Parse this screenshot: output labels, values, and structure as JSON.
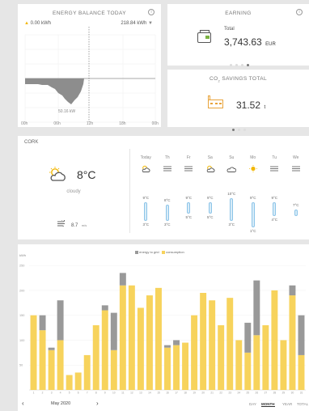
{
  "energy": {
    "title": "ENERGY BALANCE TODAY",
    "left_value": "0.00 kWh",
    "right_value": "218.84 kWh",
    "min_label": "50.16 kW",
    "x_ticks": [
      "00h",
      "06h",
      "12h",
      "18h",
      "00h"
    ]
  },
  "earning": {
    "title": "EARNING",
    "label": "Total",
    "value": "3,743.63",
    "unit": "EUR"
  },
  "savings": {
    "title": "CO2 SAVINGS TOTAL",
    "value": "31.52",
    "unit": "t"
  },
  "weather": {
    "city": "CORK",
    "temp": "8°C",
    "condition": "cloudy",
    "wind": "8.7",
    "wind_unit": "m/s",
    "days": [
      {
        "name": "Today",
        "icon": "partly-cloudy",
        "max": "9°C",
        "min": "3°C",
        "fmax": 0.6,
        "fmin": 0.2
      },
      {
        "name": "Th",
        "icon": "fog",
        "max": "8°C",
        "min": "3°C",
        "fmax": 0.55,
        "fmin": 0.2
      },
      {
        "name": "Fr",
        "icon": "fog",
        "max": "9°C",
        "min": "5°C",
        "fmax": 0.6,
        "fmin": 0.35
      },
      {
        "name": "Sa",
        "icon": "partly-cloudy",
        "max": "9°C",
        "min": "5°C",
        "fmax": 0.6,
        "fmin": 0.35
      },
      {
        "name": "Su",
        "icon": "cloud",
        "max": "10°C",
        "min": "3°C",
        "fmax": 0.7,
        "fmin": 0.2
      },
      {
        "name": "Mo",
        "icon": "sun",
        "max": "9°C",
        "min": "1°C",
        "fmax": 0.6,
        "fmin": 0.05
      },
      {
        "name": "Tu",
        "icon": "fog",
        "max": "9°C",
        "min": "4°C",
        "fmax": 0.6,
        "fmin": 0.3
      },
      {
        "name": "We",
        "icon": "fog",
        "max": "7°C",
        "min": "",
        "fmax": 0.45,
        "fmin": 0.3
      }
    ]
  },
  "chart_data": {
    "type": "bar",
    "legend": [
      "energy to grid",
      "consumption"
    ],
    "colors": {
      "grid": "#999999",
      "consumption": "#f7d35c"
    },
    "ylabel": "kWh",
    "y_ticks": [
      "250",
      "200",
      "150",
      "100",
      "50"
    ],
    "ylim": [
      0,
      260
    ],
    "categories": [
      "1",
      "2",
      "3",
      "4",
      "5",
      "6",
      "7",
      "8",
      "9",
      "10",
      "11",
      "12",
      "13",
      "14",
      "15",
      "16",
      "17",
      "18",
      "19",
      "20",
      "21",
      "22",
      "23",
      "24",
      "25",
      "26",
      "27",
      "28",
      "29",
      "30",
      "31"
    ],
    "series": [
      {
        "name": "consumption",
        "values": [
          150,
          120,
          80,
          100,
          30,
          35,
          70,
          130,
          160,
          80,
          210,
          210,
          165,
          190,
          205,
          85,
          90,
          95,
          150,
          195,
          180,
          130,
          185,
          100,
          75,
          110,
          130,
          200,
          100,
          190,
          70
        ]
      },
      {
        "name": "energy to grid",
        "values": [
          0,
          30,
          5,
          80,
          0,
          0,
          0,
          0,
          10,
          75,
          25,
          0,
          0,
          0,
          0,
          5,
          10,
          0,
          0,
          0,
          0,
          0,
          0,
          0,
          60,
          110,
          0,
          0,
          0,
          20,
          80
        ]
      }
    ]
  },
  "footer": {
    "month": "May 2020",
    "tabs": [
      "DAY",
      "MONTH",
      "YEAR",
      "TOTAL"
    ],
    "active_tab": "MONTH"
  }
}
